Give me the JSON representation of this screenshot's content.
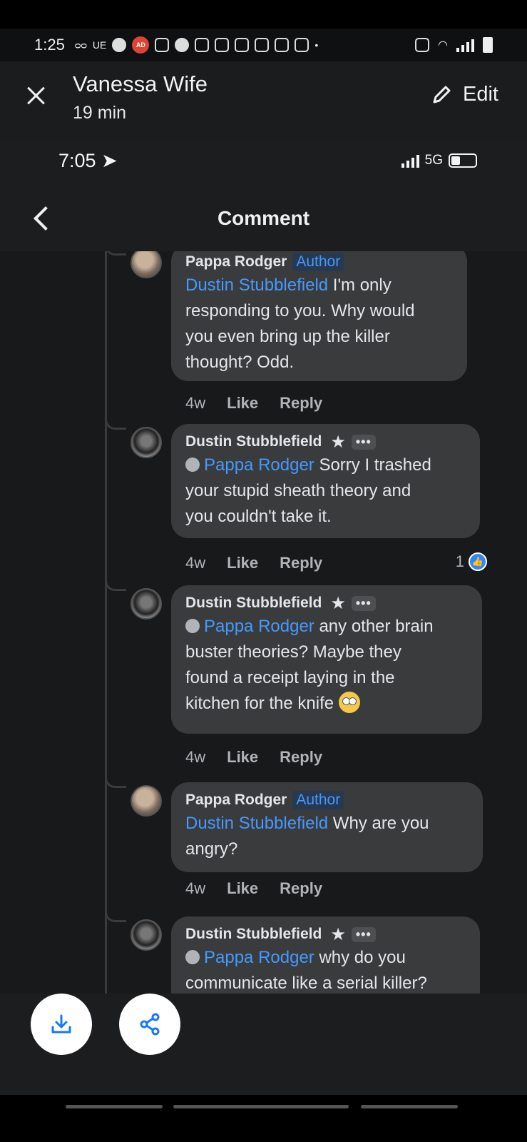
{
  "outer_status": {
    "time": "1:25",
    "carrier": "UE",
    "ad_badge": "AD"
  },
  "viewer": {
    "title": "Vanessa Wife",
    "subtitle": "19 min",
    "edit_label": "Edit"
  },
  "inner_status": {
    "time": "7:05",
    "network": "5G"
  },
  "nav": {
    "title": "Comment"
  },
  "comments": [
    {
      "author": "Pappa Rodger",
      "tag": "Author",
      "mention": "Dustin Stubblefield",
      "lines": [
        "I'm only",
        "responding to you. Why would",
        "you even bring up the killer",
        "thought?  Odd."
      ],
      "age": "4w",
      "like": "Like",
      "reply": "Reply"
    },
    {
      "author": "Dustin Stubblefield",
      "mention": "Pappa Rodger",
      "lines": [
        "Sorry I trashed",
        "your stupid sheath theory and",
        "you couldn't take it."
      ],
      "age": "4w",
      "like": "Like",
      "reply": "Reply",
      "reactions": "1"
    },
    {
      "author": "Dustin Stubblefield",
      "mention": "Pappa Rodger",
      "lines": [
        "any other brain",
        "buster theories? Maybe they",
        "found a receipt laying in the",
        "kitchen for the knife"
      ],
      "age": "4w",
      "like": "Like",
      "reply": "Reply"
    },
    {
      "author": "Pappa Rodger",
      "tag": "Author",
      "mention": "Dustin Stubblefield",
      "lines": [
        "Why are you",
        "angry?"
      ],
      "age": "4w",
      "like": "Like",
      "reply": "Reply"
    },
    {
      "author": "Dustin Stubblefield",
      "mention": "Pappa Rodger",
      "lines": [
        "why do you",
        "communicate like a serial killer?"
      ]
    }
  ],
  "more_label": "•••",
  "icons": {
    "download": "download-icon",
    "share": "share-icon",
    "close": "close-icon",
    "edit": "pencil-icon",
    "back": "chevron-left-icon"
  }
}
